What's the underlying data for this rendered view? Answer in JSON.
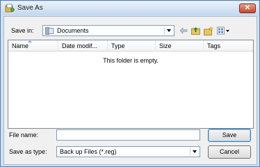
{
  "window": {
    "title": "Save As",
    "close_label": "✕"
  },
  "toolbar": {
    "save_in_label": "Save in:",
    "save_in_value": "Documents"
  },
  "columns": [
    "Name",
    "Date modif...",
    "Type",
    "Size",
    "Tags"
  ],
  "list": {
    "empty_text": "This folder is empty."
  },
  "form": {
    "file_name_label": "File name:",
    "file_name_value": "",
    "save_type_label": "Save as type:",
    "save_type_value": "Back up Files (*.reg)"
  },
  "buttons": {
    "save": "Save",
    "cancel": "Cancel"
  },
  "colors": {
    "title_bg": "#c5d8ee",
    "close_bg": "#c6442c",
    "accent": "#3c7fb1"
  }
}
